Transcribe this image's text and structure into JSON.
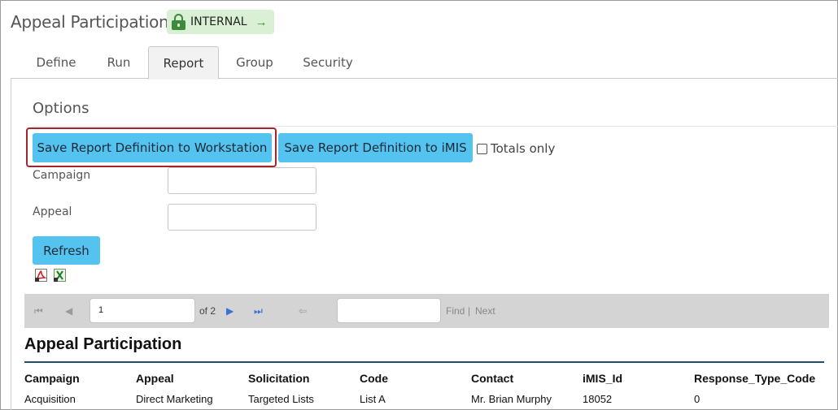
{
  "header": {
    "title": "Appeal Participation",
    "badge": {
      "label": "INTERNAL",
      "icon": "lock-icon",
      "arrow": "→",
      "color": "#d9f0d4",
      "accent": "#3c8a3a"
    }
  },
  "tabs": [
    {
      "label": "Define",
      "active": false
    },
    {
      "label": "Run",
      "active": false
    },
    {
      "label": "Report",
      "active": true
    },
    {
      "label": "Group",
      "active": false
    },
    {
      "label": "Security",
      "active": false
    }
  ],
  "options": {
    "title": "Options",
    "save_workstation_label": "Save Report Definition to Workstation",
    "save_imis_label": "Save Report Definition to iMIS",
    "totals_only_label": "Totals only",
    "totals_only_checked": false,
    "campaign_label": "Campaign",
    "campaign_value": "",
    "appeal_label": "Appeal",
    "appeal_value": "",
    "refresh_label": "Refresh",
    "button_color": "#55c3f0",
    "highlight_color": "#a3262e"
  },
  "exports": {
    "pdf_icon": "pdf-export-icon",
    "excel_icon": "excel-export-icon"
  },
  "pager": {
    "page_value": "1",
    "of_text": "of 2",
    "find_value": "",
    "find_label": "Find",
    "separator": "|",
    "next_label": "Next"
  },
  "report": {
    "title": "Appeal Participation",
    "columns": [
      "Campaign",
      "Appeal",
      "Solicitation",
      "Code",
      "Contact",
      "iMIS_Id",
      "Response_Type_Code"
    ],
    "rows": [
      [
        "Acquisition",
        "Direct Marketing",
        "Targeted Lists",
        "List A",
        "Mr. Brian Murphy",
        "18052",
        "0"
      ]
    ]
  }
}
